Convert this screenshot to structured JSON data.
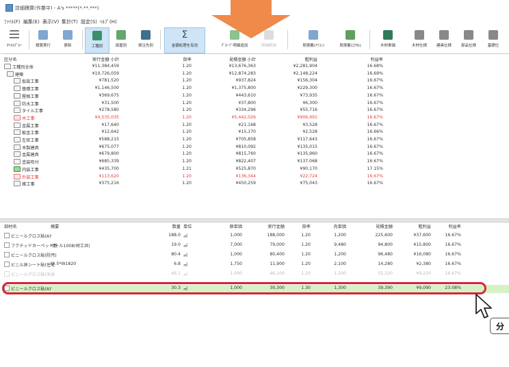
{
  "window": {
    "title": "詳細積算(作業中) - A's *****(*.**.***)"
  },
  "menu": [
    "ﾌｧｲﾙ(F)",
    "編集(E)",
    "表示(V)",
    "集計(T)",
    "設定(S)",
    "ﾍﾙﾌﾟ(H)"
  ],
  "toolbar": [
    {
      "label": "ﾀｲﾄﾙｸﾞﾙｰ",
      "icon": "menu-icon"
    },
    {
      "label": "積算実行",
      "icon": "calc-run-icon"
    },
    {
      "label": "更新",
      "icon": "refresh-icon"
    },
    {
      "label": "工種別",
      "icon": "by-type-icon"
    },
    {
      "label": "部屋別",
      "icon": "by-room-icon"
    },
    {
      "label": "発注先別",
      "icon": "by-vendor-icon"
    },
    {
      "label": "金額処理を有効",
      "icon": "sigma-icon"
    },
    {
      "label": "ｸﾞﾙｰﾌﾟ明細追加",
      "icon": "add-detail-icon"
    },
    {
      "label": "明細削除",
      "icon": "delete-detail-icon"
    },
    {
      "label": "見積書(ｱｲｺﾝ)",
      "icon": "estimate-icon"
    },
    {
      "label": "見積書(ｴｸｾﾙ)",
      "icon": "estimate-excel-icon"
    },
    {
      "label": "木材単価",
      "icon": "wood-price-icon"
    },
    {
      "label": "木材仕様",
      "icon": "wood-spec-icon"
    },
    {
      "label": "建具仕様",
      "icon": "fitting-spec-icon"
    },
    {
      "label": "部品仕様",
      "icon": "parts-spec-icon"
    },
    {
      "label": "基礎仕",
      "icon": "foundation-spec-icon"
    }
  ],
  "summary": {
    "headers": {
      "name": "区分名",
      "amount": "実行金額 小計",
      "rate": "掛率",
      "estimate": "見積金額 小計",
      "profit": "粗利益",
      "pct": "利益率"
    },
    "rows": [
      {
        "name": "工種別全体",
        "amount": "¥11,384,459",
        "rate": "1.20",
        "estimate": "¥13,676,363",
        "profit": "¥2,281,904",
        "pct": "16.68%"
      },
      {
        "name": "建築",
        "amount": "¥10,726,059",
        "rate": "1.20",
        "estimate": "¥12,874,283",
        "profit": "¥2,148,224",
        "pct": "16.69%"
      },
      {
        "name": "仮設工事",
        "amount": "¥781,520",
        "rate": "1.20",
        "estimate": "¥937,824",
        "profit": "¥156,304",
        "pct": "16.67%"
      },
      {
        "name": "基礎工事",
        "amount": "¥1,146,500",
        "rate": "1.20",
        "estimate": "¥1,375,800",
        "profit": "¥229,300",
        "pct": "16.67%"
      },
      {
        "name": "屋根工事",
        "amount": "¥369,675",
        "rate": "1.20",
        "estimate": "¥443,610",
        "profit": "¥73,935",
        "pct": "16.67%"
      },
      {
        "name": "防水工事",
        "amount": "¥31,500",
        "rate": "1.20",
        "estimate": "¥37,800",
        "profit": "¥6,300",
        "pct": "16.67%"
      },
      {
        "name": "タイル工事",
        "amount": "¥278,580",
        "rate": "1.20",
        "estimate": "¥334,296",
        "profit": "¥55,716",
        "pct": "16.67%"
      },
      {
        "name": "木工事",
        "amount": "¥4,535,035",
        "rate": "1.20",
        "estimate": "¥5,442,026",
        "profit": "¥906,991",
        "pct": "16.67%",
        "red": true
      },
      {
        "name": "金属工事",
        "amount": "¥17,640",
        "rate": "1.20",
        "estimate": "¥21,168",
        "profit": "¥3,528",
        "pct": "16.67%"
      },
      {
        "name": "板金工事",
        "amount": "¥12,642",
        "rate": "1.20",
        "estimate": "¥15,170",
        "profit": "¥2,528",
        "pct": "16.66%"
      },
      {
        "name": "左官工事",
        "amount": "¥588,215",
        "rate": "1.20",
        "estimate": "¥705,858",
        "profit": "¥117,643",
        "pct": "16.67%"
      },
      {
        "name": "木製建具",
        "amount": "¥675,077",
        "rate": "1.20",
        "estimate": "¥810,092",
        "profit": "¥135,015",
        "pct": "16.67%"
      },
      {
        "name": "金属建具",
        "amount": "¥679,800",
        "rate": "1.20",
        "estimate": "¥815,760",
        "profit": "¥135,960",
        "pct": "16.67%"
      },
      {
        "name": "塗装吹付",
        "amount": "¥685,339",
        "rate": "1.20",
        "estimate": "¥822,407",
        "profit": "¥137,068",
        "pct": "16.67%"
      },
      {
        "name": "内装工事",
        "amount": "¥435,700",
        "rate": "1.21",
        "estimate": "¥525,870",
        "profit": "¥90,170",
        "pct": "17.15%",
        "green": true
      },
      {
        "name": "外装工事",
        "amount": "¥113,620",
        "rate": "1.20",
        "estimate": "¥136,344",
        "profit": "¥22,724",
        "pct": "16.67%",
        "red": true
      },
      {
        "name": "雑工事",
        "amount": "¥375,216",
        "rate": "1.20",
        "estimate": "¥450,259",
        "profit": "¥75,043",
        "pct": "16.67%"
      }
    ]
  },
  "detail": {
    "headers": {
      "name": "部材名",
      "spec": "摘要",
      "qty": "数量",
      "unit": "単位",
      "cost": "原単価",
      "exec": "実行金額",
      "rate": "掛率",
      "sell": "売単価",
      "est": "見積金額",
      "prof": "粗利益",
      "pct": "利益率"
    },
    "rows": [
      {
        "name": "ビニールクロス貼(A)",
        "spec": "-",
        "qty": "188.0",
        "unit": "㎡",
        "cost": "1,000",
        "exec": "188,000",
        "rate": "1.20",
        "sell": "1,200",
        "est": "225,600",
        "prof": "¥37,600",
        "pct": "16.67%"
      },
      {
        "name": "フクテッドカーペット敷",
        "spec": "ウール1008(材工共)",
        "qty": "19.0",
        "unit": "㎡",
        "cost": "7,000",
        "exec": "79,000",
        "rate": "1.20",
        "sell": "9,480",
        "est": "94,800",
        "prof": "¥15,800",
        "pct": "16.67%"
      },
      {
        "name": "ビニールクロス貼(防汚)",
        "spec": "-",
        "qty": "80.4",
        "unit": "㎡",
        "cost": "1,000",
        "exec": "80,400",
        "rate": "1.20",
        "sell": "1,200",
        "est": "96,480",
        "prof": "¥16,080",
        "pct": "16.67%"
      },
      {
        "name": "ビニル床シート貼(住宅",
        "spec": "t2.5*W1820",
        "qty": "6.8",
        "unit": "㎡",
        "cost": "1,750",
        "exec": "11,900",
        "rate": "1.20",
        "sell": "2,100",
        "est": "14,280",
        "prof": "¥2,380",
        "pct": "16.67%"
      },
      {
        "name": "ビニールクロス貼(天井",
        "spec": "",
        "qty": "46.1",
        "unit": "㎡",
        "cost": "1,000",
        "exec": "46,100",
        "rate": "1.20",
        "sell": "1,200",
        "est": "55,320",
        "prof": "¥9,220",
        "pct": "16.67%",
        "faded": true
      },
      {
        "name": "ビニールクロス貼(A)",
        "spec": "-",
        "qty": "30.3",
        "unit": "㎡",
        "cost": "1,000",
        "exec": "30,300",
        "rate": "1.30",
        "sell": "1,300",
        "est": "39,390",
        "prof": "¥9,090",
        "pct": "23.08%",
        "highlight": true
      }
    ]
  },
  "callout_text": "分",
  "colors": {
    "highlight_border": "#d82438",
    "highlight_row": "#d6f2c5",
    "red_text": "#e43a3a",
    "arrow": "#f08a4b"
  }
}
